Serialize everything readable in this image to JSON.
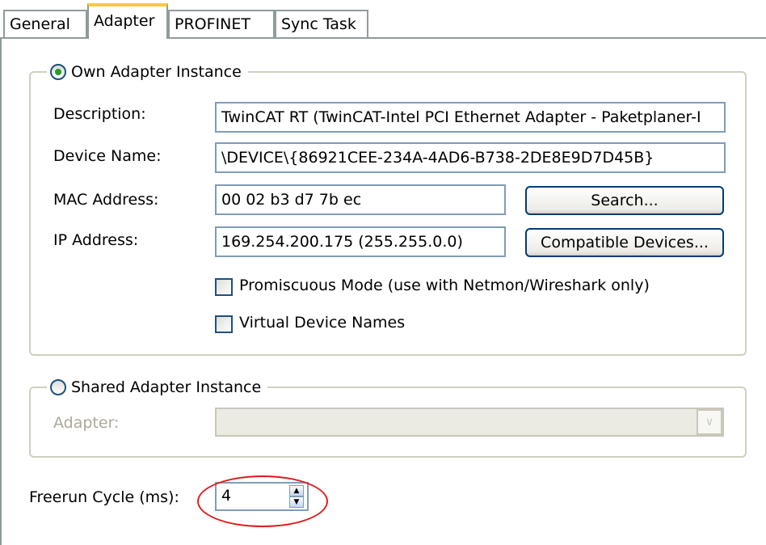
{
  "tabs": [
    {
      "label": "General"
    },
    {
      "label": "Adapter"
    },
    {
      "label": "PROFINET"
    },
    {
      "label": "Sync Task"
    }
  ],
  "own_adapter": {
    "radio_label": "Own Adapter Instance",
    "selected": true,
    "description_label": "Description:",
    "description_value": "TwinCAT RT (TwinCAT-Intel PCI Ethernet Adapter - Paketplaner-I",
    "device_name_label": "Device Name:",
    "device_name_value": "\\DEVICE\\{86921CEE-234A-4AD6-B738-2DE8E9D7D45B}",
    "mac_label": "MAC Address:",
    "mac_value": "00 02 b3 d7 7b ec",
    "search_button": "Search...",
    "ip_label": "IP Address:",
    "ip_value": "169.254.200.175 (255.255.0.0)",
    "compatible_button": "Compatible Devices...",
    "promiscuous_label": "Promiscuous Mode (use with Netmon/Wireshark only)",
    "promiscuous_checked": false,
    "virtual_names_label": "Virtual Device Names",
    "virtual_names_checked": false
  },
  "shared_adapter": {
    "radio_label": "Shared Adapter Instance",
    "selected": false,
    "adapter_label": "Adapter:",
    "adapter_value": ""
  },
  "freerun": {
    "label": "Freerun Cycle (ms):",
    "value": "4"
  },
  "colors": {
    "highlight_ellipse": "#e41a1a",
    "active_tab_accent": "#ffc83c"
  }
}
